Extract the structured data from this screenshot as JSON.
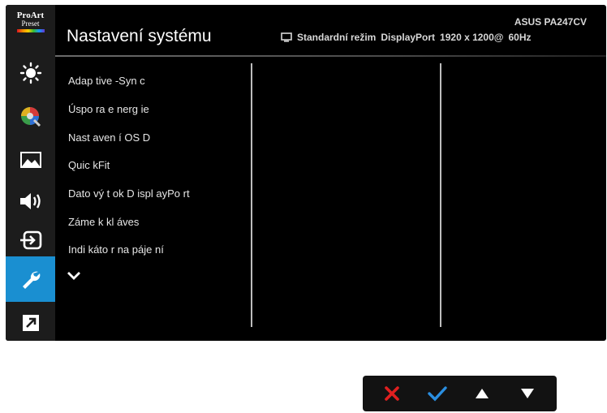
{
  "logo": {
    "line1": "ProArt",
    "line2": "Preset"
  },
  "sidebar": {
    "items": [
      {
        "icon": "brightness-icon"
      },
      {
        "icon": "color-icon"
      },
      {
        "icon": "image-icon"
      },
      {
        "icon": "sound-icon"
      },
      {
        "icon": "input-select-icon"
      },
      {
        "icon": "wrench-icon",
        "active": true
      },
      {
        "icon": "shortcut-icon"
      }
    ],
    "active_color": "#1a8fd1"
  },
  "header": {
    "title": "Nastavení systému",
    "model": "ASUS PA247CV",
    "mode": "Standardní režim",
    "input": "DisplayPort",
    "resolution": "1920 x 1200@",
    "refresh": "60Hz"
  },
  "menu": {
    "items": [
      "Adap tive -Syn c",
      "Úspo ra e nerg ie",
      "Nast aven í OS D",
      "Quic kFit",
      "Dato vý t ok D ispl ayPo rt",
      "Záme k kl áves",
      "Indi káto r na páje ní"
    ],
    "more_icon": "chevron-down-icon"
  },
  "keys": [
    {
      "icon": "close-icon",
      "color": "#e02020"
    },
    {
      "icon": "check-icon",
      "color": "#2a8ee0"
    },
    {
      "icon": "arrow-up-icon",
      "color": "#ffffff"
    },
    {
      "icon": "arrow-down-icon",
      "color": "#ffffff"
    }
  ]
}
